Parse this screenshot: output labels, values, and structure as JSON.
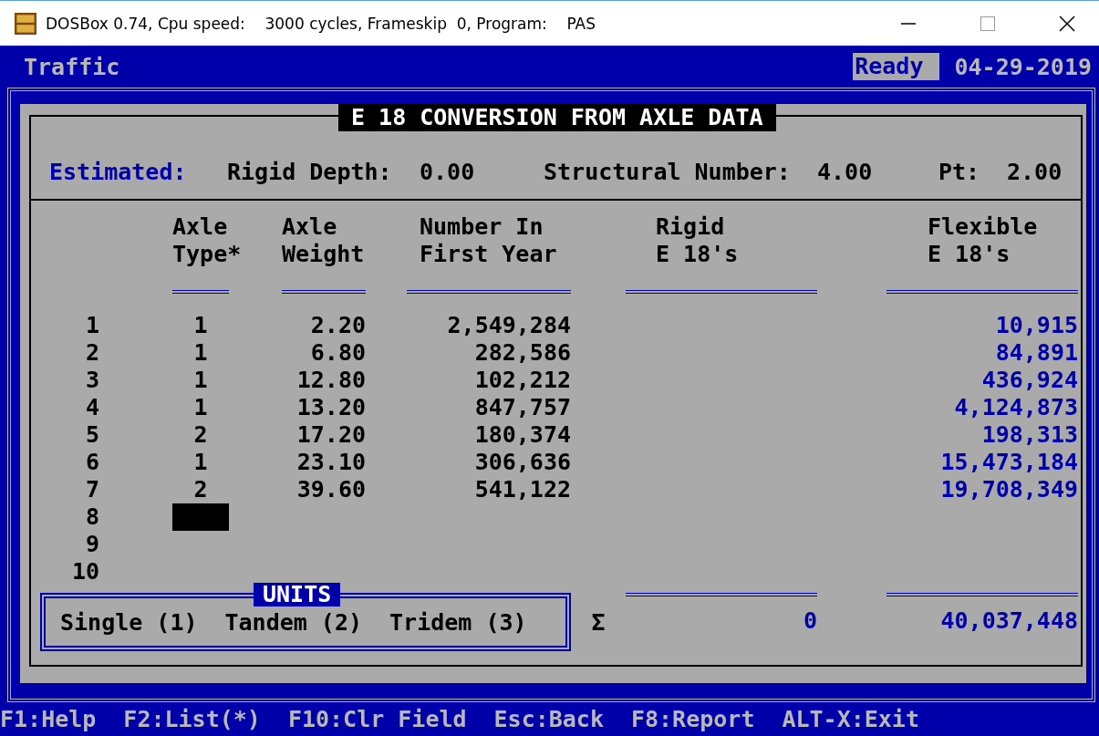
{
  "window": {
    "title": "DOSBox 0.74, Cpu speed:    3000 cycles, Frameskip  0, Program:    PAS"
  },
  "app_bar": {
    "title": "Traffic",
    "status": "Ready",
    "date": "04-29-2019"
  },
  "form": {
    "title": "E 18 CONVERSION FROM AXLE DATA",
    "estimated": {
      "label": "Estimated:",
      "fields": [
        {
          "label": "Rigid Depth:",
          "value": "0.00"
        },
        {
          "label": "Structural Number:",
          "value": "4.00"
        },
        {
          "label": "Pt:",
          "value": "2.00"
        }
      ]
    },
    "columns": [
      {
        "line1": "Axle",
        "line2": "Type*"
      },
      {
        "line1": "Axle",
        "line2": "Weight"
      },
      {
        "line1": "Number In",
        "line2": "First Year"
      },
      {
        "line1": "Rigid",
        "line2": "E 18's"
      },
      {
        "line1": "Flexible",
        "line2": "E 18's"
      }
    ],
    "rows": [
      {
        "index": "1",
        "axle_type": "1",
        "axle_weight": "2.20",
        "number_first_year": "2,549,284",
        "flexible": "10,915",
        "editing": false
      },
      {
        "index": "2",
        "axle_type": "1",
        "axle_weight": "6.80",
        "number_first_year": "282,586",
        "flexible": "84,891",
        "editing": false
      },
      {
        "index": "3",
        "axle_type": "1",
        "axle_weight": "12.80",
        "number_first_year": "102,212",
        "flexible": "436,924",
        "editing": false
      },
      {
        "index": "4",
        "axle_type": "1",
        "axle_weight": "13.20",
        "number_first_year": "847,757",
        "flexible": "4,124,873",
        "editing": false
      },
      {
        "index": "5",
        "axle_type": "2",
        "axle_weight": "17.20",
        "number_first_year": "180,374",
        "flexible": "198,313",
        "editing": false
      },
      {
        "index": "6",
        "axle_type": "1",
        "axle_weight": "23.10",
        "number_first_year": "306,636",
        "flexible": "15,473,184",
        "editing": false
      },
      {
        "index": "7",
        "axle_type": "2",
        "axle_weight": "39.60",
        "number_first_year": "541,122",
        "flexible": "19,708,349",
        "editing": false
      },
      {
        "index": "8",
        "editing": true
      },
      {
        "index": "9",
        "editing": false
      },
      {
        "index": "10",
        "editing": false
      }
    ],
    "units": {
      "title": "UNITS",
      "options": [
        "Single (1)",
        "Tandem (2)",
        "Tridem (3)"
      ]
    },
    "totals": {
      "symbol": "Σ",
      "rigid": "0",
      "flexible": "40,037,448"
    }
  },
  "function_keys": [
    "F1:Help",
    "F2:List(*)",
    "F10:Clr Field",
    "Esc:Back",
    "F8:Report",
    "ALT-X:Exit"
  ]
}
